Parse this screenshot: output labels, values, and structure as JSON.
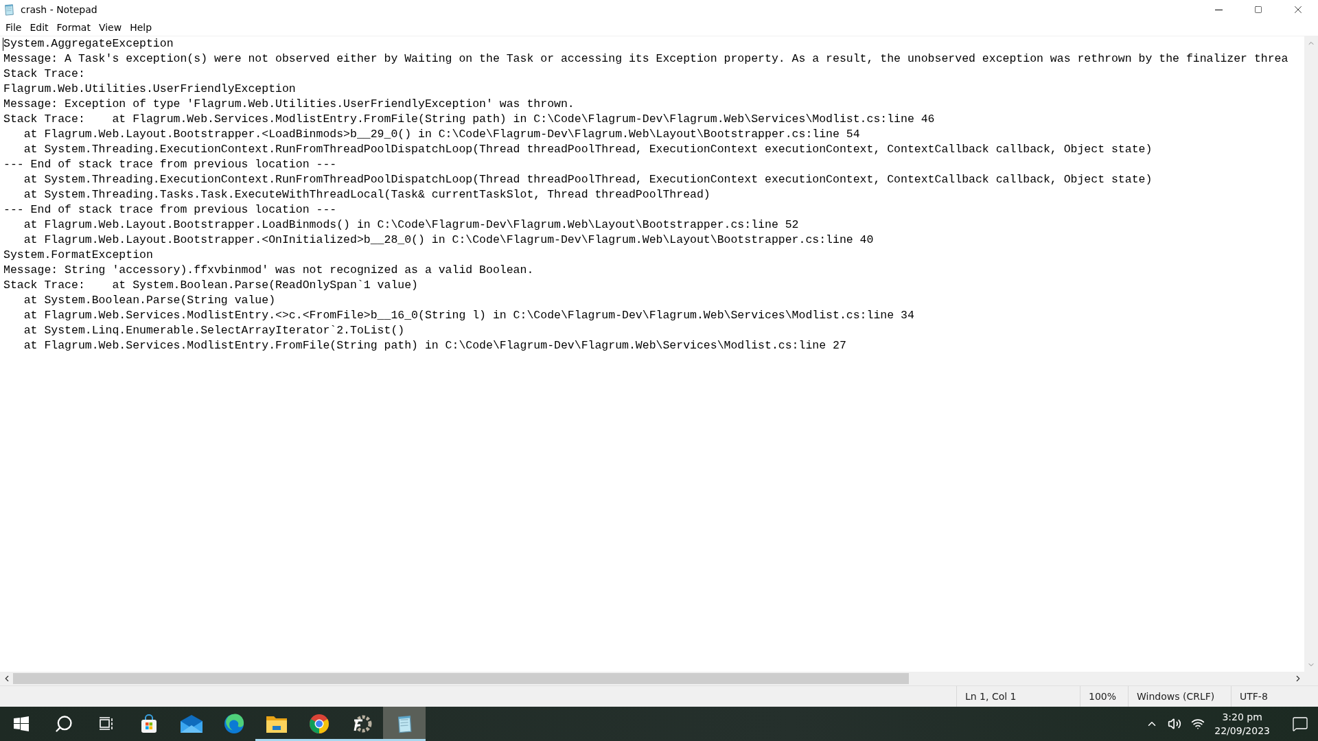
{
  "window": {
    "title": "crash - Notepad"
  },
  "menu": [
    "File",
    "Edit",
    "Format",
    "View",
    "Help"
  ],
  "lines": [
    "System.AggregateException",
    "Message: A Task's exception(s) were not observed either by Waiting on the Task or accessing its Exception property. As a result, the unobserved exception was rethrown by the finalizer threa",
    "Stack Trace:",
    "Flagrum.Web.Utilities.UserFriendlyException",
    "Message: Exception of type 'Flagrum.Web.Utilities.UserFriendlyException' was thrown.",
    "Stack Trace:    at Flagrum.Web.Services.ModlistEntry.FromFile(String path) in C:\\Code\\Flagrum-Dev\\Flagrum.Web\\Services\\Modlist.cs:line 46",
    "   at Flagrum.Web.Layout.Bootstrapper.<LoadBinmods>b__29_0() in C:\\Code\\Flagrum-Dev\\Flagrum.Web\\Layout\\Bootstrapper.cs:line 54",
    "   at System.Threading.ExecutionContext.RunFromThreadPoolDispatchLoop(Thread threadPoolThread, ExecutionContext executionContext, ContextCallback callback, Object state)",
    "--- End of stack trace from previous location ---",
    "   at System.Threading.ExecutionContext.RunFromThreadPoolDispatchLoop(Thread threadPoolThread, ExecutionContext executionContext, ContextCallback callback, Object state)",
    "   at System.Threading.Tasks.Task.ExecuteWithThreadLocal(Task& currentTaskSlot, Thread threadPoolThread)",
    "--- End of stack trace from previous location ---",
    "   at Flagrum.Web.Layout.Bootstrapper.LoadBinmods() in C:\\Code\\Flagrum-Dev\\Flagrum.Web\\Layout\\Bootstrapper.cs:line 52",
    "   at Flagrum.Web.Layout.Bootstrapper.<OnInitialized>b__28_0() in C:\\Code\\Flagrum-Dev\\Flagrum.Web\\Layout\\Bootstrapper.cs:line 40",
    "System.FormatException",
    "Message: String 'accessory).ffxvbinmod' was not recognized as a valid Boolean.",
    "Stack Trace:    at System.Boolean.Parse(ReadOnlySpan`1 value)",
    "   at System.Boolean.Parse(String value)",
    "   at Flagrum.Web.Services.ModlistEntry.<>c.<FromFile>b__16_0(String l) in C:\\Code\\Flagrum-Dev\\Flagrum.Web\\Services\\Modlist.cs:line 34",
    "   at System.Linq.Enumerable.SelectArrayIterator`2.ToList()",
    "   at Flagrum.Web.Services.ModlistEntry.FromFile(String path) in C:\\Code\\Flagrum-Dev\\Flagrum.Web\\Services\\Modlist.cs:line 27"
  ],
  "status_bar": [
    "Ln 1, Col 1",
    "100%",
    "Windows (CRLF)",
    "UTF-8"
  ],
  "taskbar": {
    "apps": [
      {
        "kind": "start",
        "running": false,
        "active": false
      },
      {
        "kind": "search",
        "running": false,
        "active": false
      },
      {
        "kind": "taskview",
        "running": false,
        "active": false
      },
      {
        "kind": "store",
        "running": false,
        "active": false
      },
      {
        "kind": "mail",
        "running": false,
        "active": false
      },
      {
        "kind": "edge",
        "running": false,
        "active": false
      },
      {
        "kind": "folder",
        "running": true,
        "active": false
      },
      {
        "kind": "chrome",
        "running": true,
        "active": false
      },
      {
        "kind": "gear",
        "running": true,
        "active": false
      },
      {
        "kind": "notepad",
        "running": true,
        "active": true
      }
    ],
    "time": "3:20 pm",
    "date": "22/09/2023"
  }
}
